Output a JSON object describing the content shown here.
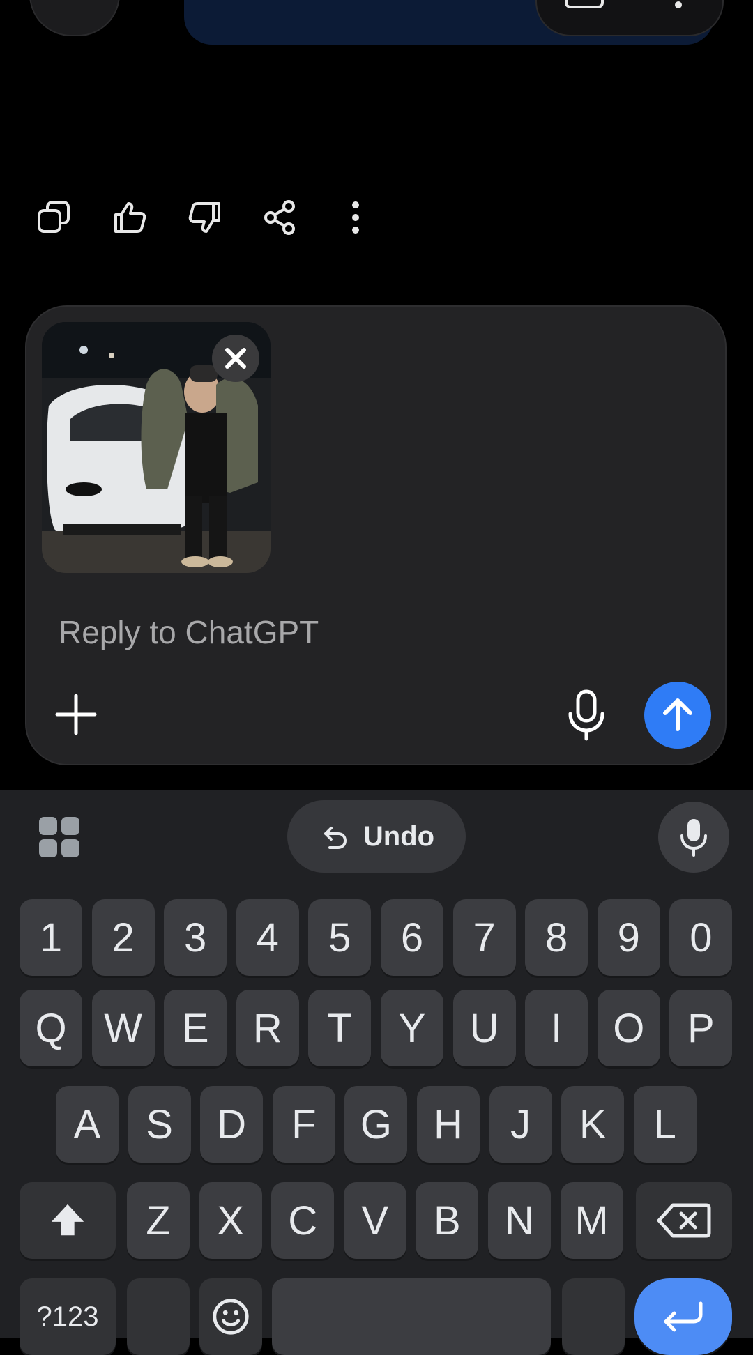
{
  "composer": {
    "placeholder": "Reply to ChatGPT",
    "attachment_close_icon": "close-icon",
    "add_icon": "plus-icon",
    "mic_icon": "microphone-icon",
    "send_icon": "arrow-up-icon",
    "send_color": "#2f7cf6"
  },
  "message_actions": [
    "copy-icon",
    "thumbs-up-icon",
    "thumbs-down-icon",
    "share-icon",
    "more-vertical-icon"
  ],
  "keyboard": {
    "undo_label": "Undo",
    "number_row": [
      "1",
      "2",
      "3",
      "4",
      "5",
      "6",
      "7",
      "8",
      "9",
      "0"
    ],
    "row1": [
      "Q",
      "W",
      "E",
      "R",
      "T",
      "Y",
      "U",
      "I",
      "O",
      "P"
    ],
    "row2": [
      "A",
      "S",
      "D",
      "F",
      "G",
      "H",
      "J",
      "K",
      "L"
    ],
    "row3": [
      "Z",
      "X",
      "C",
      "V",
      "B",
      "N",
      "M"
    ],
    "symbols_label": "?123"
  }
}
